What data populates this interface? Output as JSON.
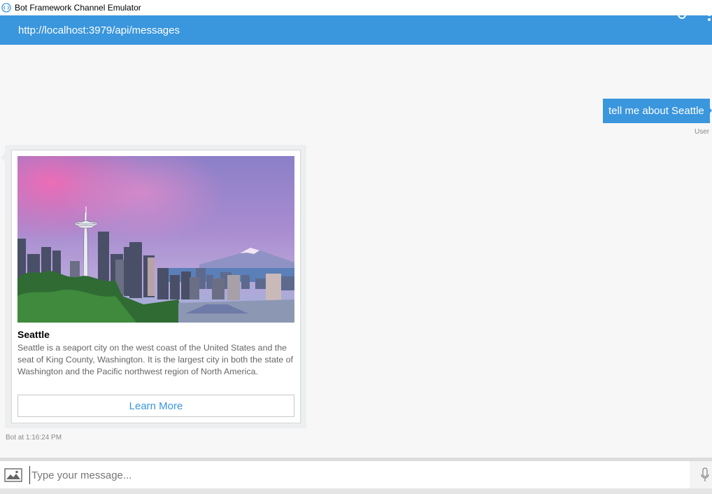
{
  "window": {
    "title": "Bot Framework Channel Emulator"
  },
  "header": {
    "endpoint": "http://localhost:3979/api/messages",
    "refresh_icon": "refresh-icon",
    "menu_icon": "more-vertical-icon"
  },
  "colors": {
    "accent": "#3a96dd",
    "transcript_bg": "#f7f7f7",
    "card_text": "#666666"
  },
  "conversation": {
    "user_message": {
      "text": "tell me about Seattle",
      "sender_label": "User"
    },
    "bot_message": {
      "card": {
        "image_subject": "Seattle skyline with Space Needle and Mount Rainier at sunset",
        "title": "Seattle",
        "text": "Seattle is a seaport city on the west coast of the United States and the seat of King County, Washington. It is the largest city in both the state of Washington and the Pacific northwest region of North America.",
        "button_label": "Learn More"
      },
      "timestamp_label": "Bot at 1:16:24 PM"
    }
  },
  "input": {
    "placeholder": "Type your message...",
    "value": "",
    "upload_icon": "image-upload-icon",
    "mic_icon": "microphone-icon"
  }
}
